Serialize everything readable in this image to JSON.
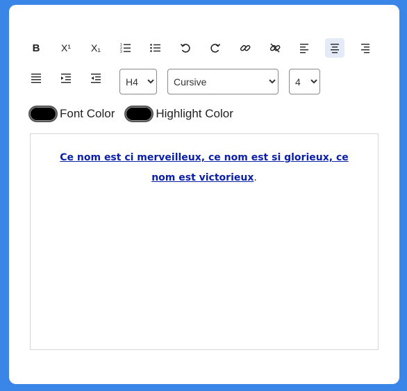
{
  "toolbar": {
    "bold_label": "B",
    "superscript_label": "X¹",
    "subscript_label": "X₁"
  },
  "heading_select": {
    "value": "H4",
    "options": [
      "H4"
    ]
  },
  "font_select": {
    "value": "Cursive",
    "options": [
      "Cursive"
    ]
  },
  "size_select": {
    "value": "4",
    "options": [
      "4"
    ]
  },
  "colors": {
    "font_color_label": "Font Color",
    "highlight_color_label": "Highlight Color",
    "font_color": "#000000",
    "highlight_color": "#000000"
  },
  "editor": {
    "text": "Ce nom est ci merveilleux, ce nom est si glorieux, ce nom est victorieux",
    "trailing": ".",
    "text_color": "#0a1fa8"
  },
  "accent": "#3a86e8"
}
